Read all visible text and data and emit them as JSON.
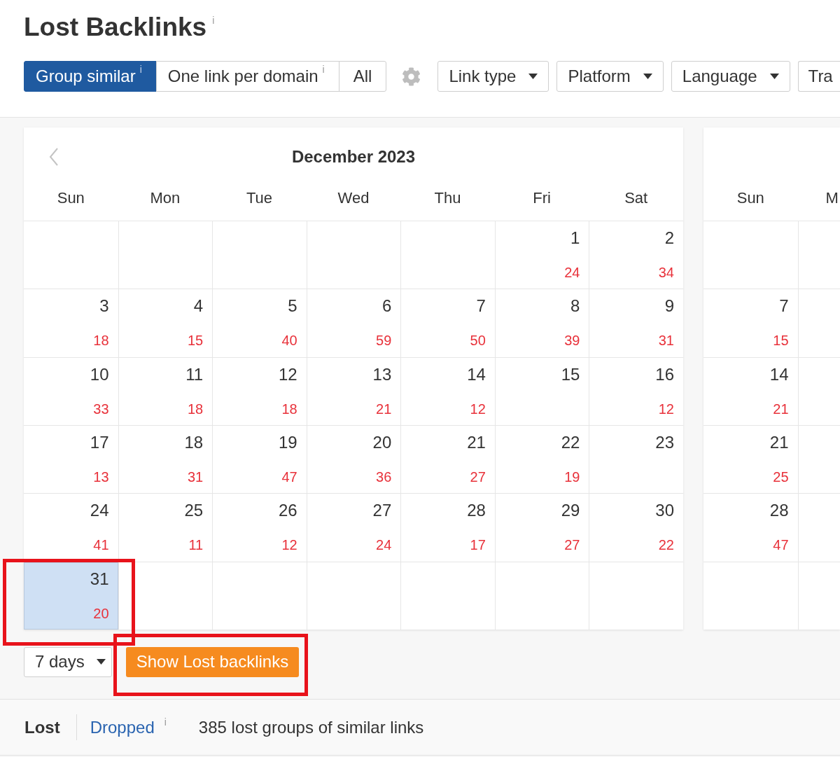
{
  "title": {
    "text": "Lost Backlinks",
    "info": "i"
  },
  "modes": [
    {
      "label": "Group similar",
      "info": "i",
      "selected": true
    },
    {
      "label": "One link per domain",
      "info": "i",
      "selected": false
    },
    {
      "label": "All",
      "selected": false
    }
  ],
  "filters": [
    {
      "label": "Link type",
      "kind": "dropdown"
    },
    {
      "label": "Platform",
      "kind": "dropdown"
    },
    {
      "label": "Language",
      "kind": "dropdown"
    },
    {
      "label": "Tra",
      "kind": "cut"
    }
  ],
  "calendars": [
    {
      "title": "December 2023",
      "prev_arrow": true,
      "weekdays": [
        "Sun",
        "Mon",
        "Tue",
        "Wed",
        "Thu",
        "Fri",
        "Sat"
      ],
      "weeks": [
        [
          {
            "kind": "blank"
          },
          {
            "kind": "blank"
          },
          {
            "kind": "blank"
          },
          {
            "kind": "blank"
          },
          {
            "kind": "blank"
          },
          {
            "kind": "day",
            "day": "1",
            "count": "24",
            "selected": false,
            "highlighted": false
          },
          {
            "kind": "day",
            "day": "2",
            "count": "34",
            "selected": false,
            "highlighted": false
          }
        ],
        [
          {
            "kind": "day",
            "day": "3",
            "count": "18",
            "selected": false,
            "highlighted": false
          },
          {
            "kind": "day",
            "day": "4",
            "count": "15",
            "selected": false,
            "highlighted": false
          },
          {
            "kind": "day",
            "day": "5",
            "count": "40",
            "selected": false,
            "highlighted": false
          },
          {
            "kind": "day",
            "day": "6",
            "count": "59",
            "selected": false,
            "highlighted": false
          },
          {
            "kind": "day",
            "day": "7",
            "count": "50",
            "selected": false,
            "highlighted": false
          },
          {
            "kind": "day",
            "day": "8",
            "count": "39",
            "selected": false,
            "highlighted": false
          },
          {
            "kind": "day",
            "day": "9",
            "count": "31",
            "selected": false,
            "highlighted": false
          }
        ],
        [
          {
            "kind": "day",
            "day": "10",
            "count": "33",
            "selected": false,
            "highlighted": false
          },
          {
            "kind": "day",
            "day": "11",
            "count": "18",
            "selected": false,
            "highlighted": false
          },
          {
            "kind": "day",
            "day": "12",
            "count": "18",
            "selected": false,
            "highlighted": false
          },
          {
            "kind": "day",
            "day": "13",
            "count": "21",
            "selected": false,
            "highlighted": false
          },
          {
            "kind": "day",
            "day": "14",
            "count": "12",
            "selected": false,
            "highlighted": false
          },
          {
            "kind": "day",
            "day": "15",
            "selected": false,
            "highlighted": false
          },
          {
            "kind": "day",
            "day": "16",
            "count": "12",
            "selected": false,
            "highlighted": false
          }
        ],
        [
          {
            "kind": "day",
            "day": "17",
            "count": "13",
            "selected": false,
            "highlighted": false
          },
          {
            "kind": "day",
            "day": "18",
            "count": "31",
            "selected": false,
            "highlighted": false
          },
          {
            "kind": "day",
            "day": "19",
            "count": "47",
            "selected": false,
            "highlighted": false
          },
          {
            "kind": "day",
            "day": "20",
            "count": "36",
            "selected": false,
            "highlighted": false
          },
          {
            "kind": "day",
            "day": "21",
            "count": "27",
            "selected": false,
            "highlighted": false
          },
          {
            "kind": "day",
            "day": "22",
            "count": "19",
            "selected": false,
            "highlighted": false
          },
          {
            "kind": "day",
            "day": "23",
            "selected": false,
            "highlighted": false
          }
        ],
        [
          {
            "kind": "day",
            "day": "24",
            "count": "41",
            "selected": false,
            "highlighted": false
          },
          {
            "kind": "day",
            "day": "25",
            "count": "11",
            "selected": false,
            "highlighted": false
          },
          {
            "kind": "day",
            "day": "26",
            "count": "12",
            "selected": false,
            "highlighted": false
          },
          {
            "kind": "day",
            "day": "27",
            "count": "24",
            "selected": false,
            "highlighted": false
          },
          {
            "kind": "day",
            "day": "28",
            "count": "17",
            "selected": false,
            "highlighted": false
          },
          {
            "kind": "day",
            "day": "29",
            "count": "27",
            "selected": false,
            "highlighted": false
          },
          {
            "kind": "day",
            "day": "30",
            "count": "22",
            "selected": false,
            "highlighted": false
          }
        ],
        [
          {
            "kind": "day",
            "day": "31",
            "count": "20",
            "selected": true,
            "highlighted": true
          },
          {
            "kind": "blank"
          },
          {
            "kind": "blank"
          },
          {
            "kind": "blank"
          },
          {
            "kind": "blank"
          },
          {
            "kind": "blank"
          },
          {
            "kind": "blank"
          }
        ]
      ]
    },
    {
      "weekdays": [
        "Sun",
        "M"
      ],
      "weeks": [
        [
          {
            "kind": "blank"
          },
          {
            "kind": "blank"
          }
        ],
        [
          {
            "kind": "day",
            "day": "7",
            "count": "15",
            "selected": false,
            "highlighted": false
          },
          {
            "kind": "blank"
          }
        ],
        [
          {
            "kind": "day",
            "day": "14",
            "count": "21",
            "selected": false,
            "highlighted": false
          },
          {
            "kind": "blank"
          }
        ],
        [
          {
            "kind": "day",
            "day": "21",
            "count": "25",
            "selected": false,
            "highlighted": false
          },
          {
            "kind": "blank"
          }
        ],
        [
          {
            "kind": "day",
            "day": "28",
            "count": "47",
            "selected": false,
            "highlighted": false
          },
          {
            "kind": "blank"
          }
        ],
        [
          {
            "kind": "blank"
          },
          {
            "kind": "blank"
          }
        ]
      ]
    }
  ],
  "period": {
    "value": "7 days"
  },
  "action_button": {
    "label": "Show Lost backlinks",
    "highlighted": true
  },
  "tabs": [
    {
      "label": "Lost",
      "selected": true
    },
    {
      "label": "Dropped",
      "info": "i",
      "selected": false
    }
  ],
  "summary": "385 lost groups of similar links"
}
